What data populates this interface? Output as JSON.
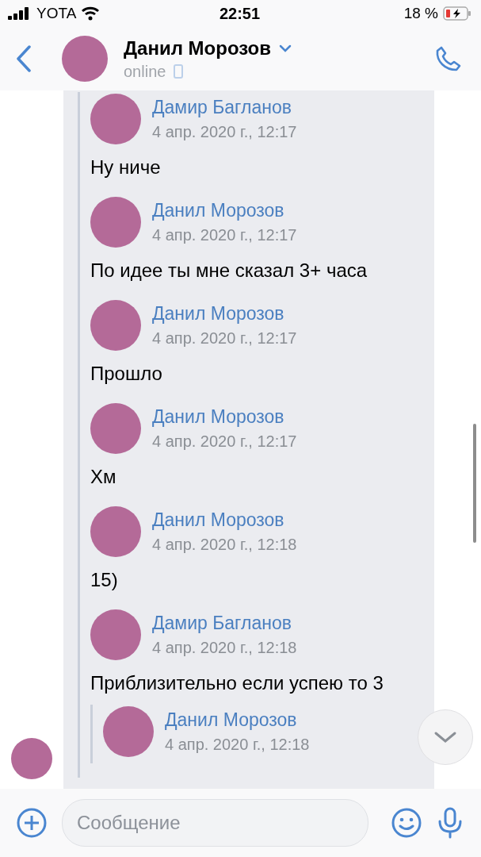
{
  "status_bar": {
    "carrier": "YOTA",
    "time": "22:51",
    "battery": "18 %"
  },
  "header": {
    "name": "Данил Морозов",
    "status": "online"
  },
  "messages": [
    {
      "author": "Дамир Багланов",
      "date": "4 апр. 2020 г., 12:17",
      "text": "Ну ниче"
    },
    {
      "author": "Данил Морозов",
      "date": "4 апр. 2020 г., 12:17",
      "text": "По идее ты мне сказал 3+ часа"
    },
    {
      "author": "Данил Морозов",
      "date": "4 апр. 2020 г., 12:17",
      "text": "Прошло"
    },
    {
      "author": "Данил Морозов",
      "date": "4 апр. 2020 г., 12:17",
      "text": "Хм"
    },
    {
      "author": "Данил Морозов",
      "date": "4 апр. 2020 г., 12:18",
      "text": "15)"
    },
    {
      "author": "Дамир Багланов",
      "date": "4 апр. 2020 г., 12:18",
      "text": "Приблизительно если успею то 3",
      "children": [
        {
          "author": "Данил Морозов",
          "date": "4 апр. 2020 г., 12:18"
        }
      ]
    }
  ],
  "composer": {
    "placeholder": "Сообщение"
  }
}
